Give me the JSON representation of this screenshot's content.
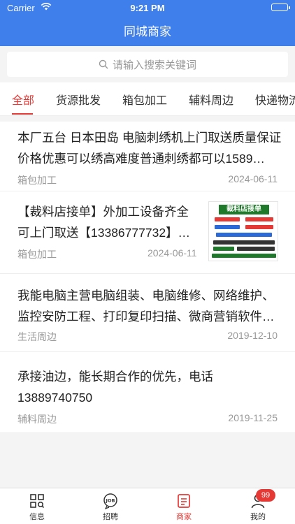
{
  "status_bar": {
    "carrier": "Carrier",
    "time": "9:21 PM"
  },
  "nav": {
    "title": "同城商家"
  },
  "search": {
    "placeholder": "请输入搜索关键词"
  },
  "tabs": [
    {
      "label": "全部",
      "active": true
    },
    {
      "label": "货源批发"
    },
    {
      "label": "箱包加工"
    },
    {
      "label": "辅料周边"
    },
    {
      "label": "快递物流"
    }
  ],
  "items": [
    {
      "title": "本厂五台 日本田岛 电脑刺绣机上门取送质量保证价格优惠可以绣高难度普通刺绣都可以1589…",
      "category": "箱包加工",
      "date": "2024-06-11"
    },
    {
      "title": "【裁料店接单】外加工设备齐全可上门取送【13386777732】…",
      "category": "箱包加工",
      "date": "2024-06-11",
      "thumb_text": "裁料店接单"
    },
    {
      "title": "我能电脑主营电脑组装、电脑维修、网络维护、监控安防工程、打印复印扫描、微商营销软件…",
      "category": "生活周边",
      "date": "2019-12-10"
    },
    {
      "title": "承接油边，能长期合作的优先，电话13889740750",
      "category": "辅料周边",
      "date": "2019-11-25"
    }
  ],
  "tabbar": {
    "items": [
      {
        "label": "信息",
        "icon": "grid-search-icon"
      },
      {
        "label": "招聘",
        "icon": "job-icon"
      },
      {
        "label": "商家",
        "icon": "document-icon",
        "active": true
      },
      {
        "label": "我的",
        "icon": "person-icon"
      }
    ],
    "badge": "99"
  },
  "colors": {
    "primary": "#3f7fec",
    "accent": "#e53935"
  }
}
